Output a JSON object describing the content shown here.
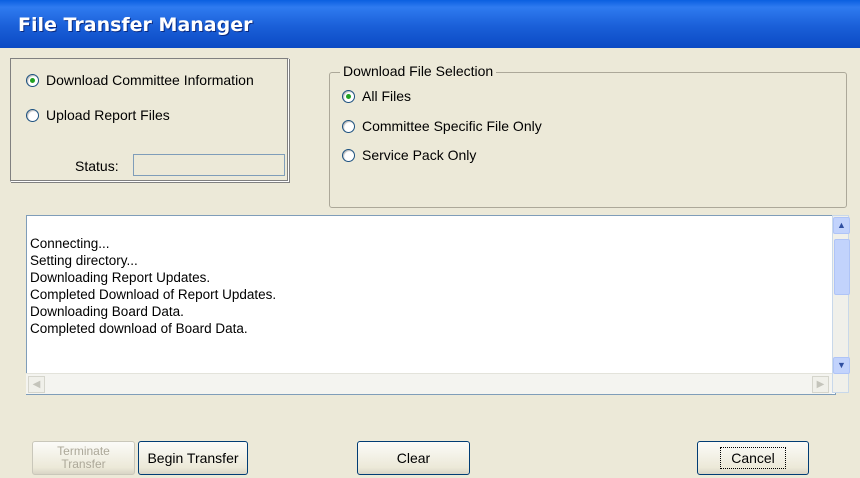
{
  "window": {
    "title": "File Transfer Manager"
  },
  "mode_options": [
    {
      "label": "Download Committee Information",
      "selected": true
    },
    {
      "label": "Upload Report Files",
      "selected": false
    }
  ],
  "status": {
    "label": "Status:",
    "value": ""
  },
  "download_selection": {
    "legend": "Download File Selection",
    "options": [
      {
        "label": "All Files",
        "selected": true
      },
      {
        "label": "Committee Specific File Only",
        "selected": false
      },
      {
        "label": "Service Pack Only",
        "selected": false
      }
    ]
  },
  "log": {
    "lines": [
      "Connecting...",
      "Setting directory...",
      "Downloading Report Updates.",
      "Completed Download of Report Updates.",
      "Downloading Board Data.",
      "Completed download of Board Data."
    ]
  },
  "buttons": {
    "terminate_line1": "Terminate",
    "terminate_line2": "Transfer",
    "begin": "Begin Transfer",
    "clear": "Clear",
    "cancel": "Cancel"
  },
  "icons": {
    "scroll_up": "chevron-up-icon",
    "scroll_down": "chevron-down-icon",
    "scroll_left": "chevron-left-icon",
    "scroll_right": "chevron-right-icon"
  }
}
